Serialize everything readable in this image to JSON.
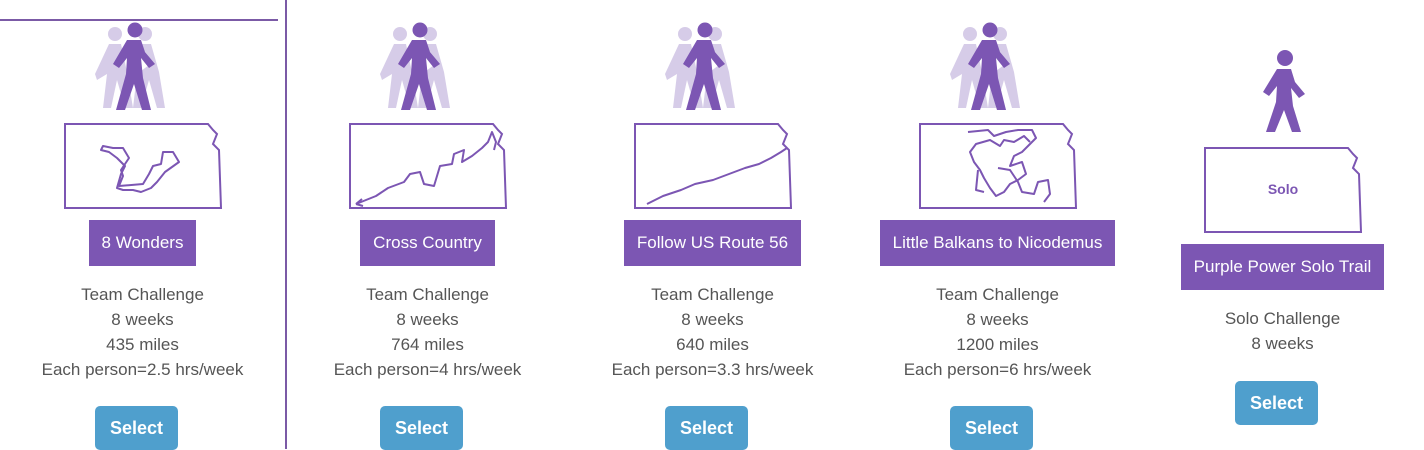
{
  "colors": {
    "accent": "#7c56b3",
    "button": "#4f9fcd",
    "walker_light": "#d6cce8"
  },
  "challenges": [
    {
      "name": "8 Wonders",
      "type": "Team Challenge",
      "duration": "8 weeks",
      "distance": "435 miles",
      "effort": "Each person=2.5 hrs/week",
      "button": "Select",
      "icon": "group-walker-icon",
      "map": "kansas-map-icon",
      "selected": true
    },
    {
      "name": "Cross Country",
      "type": "Team Challenge",
      "duration": "8 weeks",
      "distance": "764 miles",
      "effort": "Each person=4 hrs/week",
      "button": "Select",
      "icon": "group-walker-icon",
      "map": "kansas-map-icon"
    },
    {
      "name": "Follow US Route 56",
      "type": "Team Challenge",
      "duration": "8 weeks",
      "distance": "640 miles",
      "effort": "Each person=3.3 hrs/week",
      "button": "Select",
      "icon": "group-walker-icon",
      "map": "kansas-map-icon"
    },
    {
      "name": "Little Balkans to Nicodemus",
      "type": "Team Challenge",
      "duration": "8 weeks",
      "distance": "1200 miles",
      "effort": "Each person=6 hrs/week",
      "button": "Select",
      "icon": "group-walker-icon",
      "map": "kansas-map-icon"
    },
    {
      "name": "Purple Power Solo Trail",
      "type": "Solo Challenge",
      "duration": "8 weeks",
      "button": "Select",
      "icon": "solo-walker-icon",
      "map": "kansas-map-icon",
      "map_label": "Solo"
    }
  ]
}
